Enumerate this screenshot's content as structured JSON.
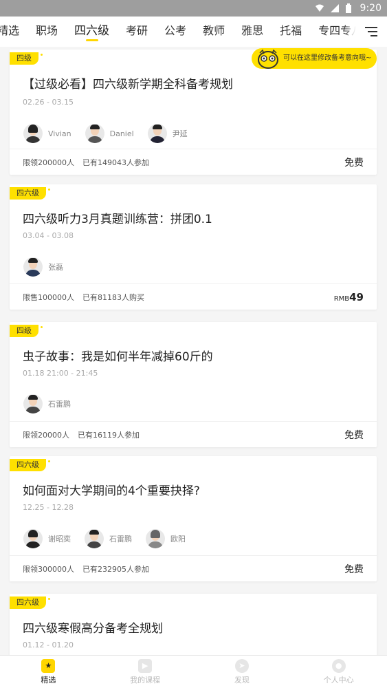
{
  "status_bar": {
    "time": "9:20"
  },
  "tabs": [
    {
      "label": "精选",
      "display": "精选"
    },
    {
      "label": "职场"
    },
    {
      "label": "四六级"
    },
    {
      "label": "考研"
    },
    {
      "label": "公考"
    },
    {
      "label": "教师"
    },
    {
      "label": "雅思"
    },
    {
      "label": "托福"
    },
    {
      "label": "专四专八"
    }
  ],
  "active_tab": "四六级",
  "tooltip": {
    "text": "可以在这里修改备考意向哦~"
  },
  "cards": [
    {
      "tag": "四级",
      "title": "【过级必看】四六级新学期全科备考规划",
      "date": "02.26 - 03.15",
      "teachers": [
        "Vivian",
        "Daniel",
        "尹延"
      ],
      "limit": "限领200000人",
      "joined": "已有149043人参加",
      "price": "免费"
    },
    {
      "tag": "四六级",
      "title": "四六级听力3月真题训练营：拼团0.1",
      "date": "03.04 - 03.08",
      "teachers": [
        "张磊"
      ],
      "limit": "限售100000人",
      "joined": "已有81183人购买",
      "price_prefix": "RMB",
      "price_amount": "49"
    },
    {
      "tag": "四级",
      "title": "虫子故事：我是如何半年减掉60斤的",
      "date": "01.18 21:00 - 21:45",
      "teachers": [
        "石雷鹏"
      ],
      "limit": "限领20000人",
      "joined": "已有16119人参加",
      "price": "免费"
    },
    {
      "tag": "四六级",
      "title": "如何面对大学期间的4个重要抉择?",
      "date": "12.25 - 12.28",
      "teachers": [
        "谢昭奕",
        "石雷鹏",
        "欧阳"
      ],
      "limit": "限领300000人",
      "joined": "已有232905人参加",
      "price": "免费"
    },
    {
      "tag": "四六级",
      "title": "四六级寒假高分备考全规划",
      "date": "01.12 - 01.20"
    }
  ],
  "bottom_nav": [
    {
      "label": "精选",
      "icon": "star-icon"
    },
    {
      "label": "我的课程",
      "icon": "play-icon"
    },
    {
      "label": "发现",
      "icon": "compass-icon"
    },
    {
      "label": "个人中心",
      "icon": "user-icon"
    }
  ],
  "colors": {
    "accent": "#ffe000",
    "status_bar": "#9e9e9e"
  }
}
